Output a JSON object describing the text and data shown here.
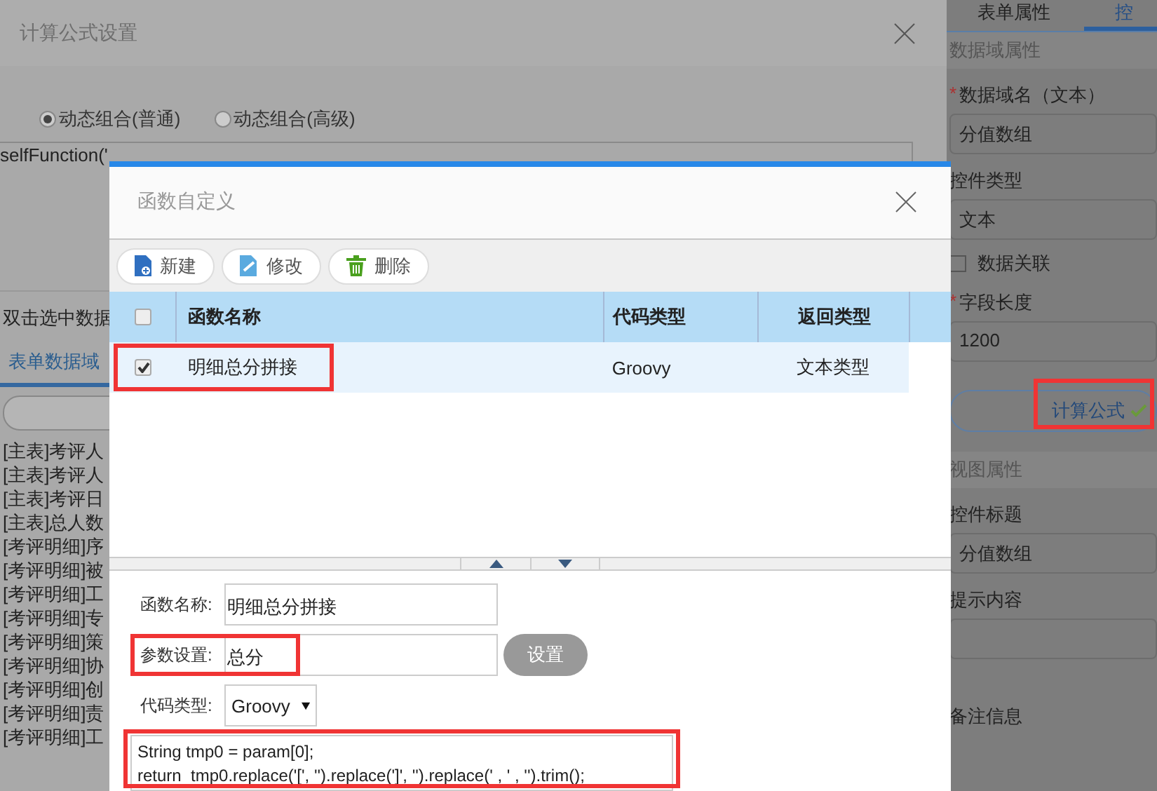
{
  "back_dialog": {
    "title": "计算公式设置",
    "radios": [
      {
        "label": "动态组合(普通)",
        "selected": true
      },
      {
        "label": "动态组合(高级)",
        "selected": false
      }
    ],
    "formula": "selfFunction('",
    "hint": "双击选中数据",
    "tab": "表单数据域",
    "fields": [
      "[主表]考评人",
      "[主表]考评人",
      "[主表]考评日",
      "[主表]总人数",
      "[考评明细]序",
      "[考评明细]被",
      "[考评明细]工",
      "[考评明细]专",
      "[考评明细]策",
      "[考评明细]协",
      "[考评明细]创",
      "[考评明细]责",
      "[考评明细]工"
    ]
  },
  "side_panel": {
    "tabs": [
      {
        "label": "表单属性",
        "selected": false
      },
      {
        "label": "控",
        "selected": true
      }
    ],
    "sections": [
      {
        "title": "数据域属性",
        "items": [
          {
            "kind": "field",
            "mark": "*",
            "label": "数据域名（文本）",
            "value": "分值数组"
          },
          {
            "kind": "field",
            "label": "控件类型",
            "value": "文本"
          },
          {
            "kind": "checkbox",
            "label": "数据关联",
            "checked": false
          },
          {
            "kind": "field",
            "mark": "*",
            "label": "字段长度",
            "value": "1200"
          },
          {
            "kind": "formula",
            "label": "计算公式",
            "set": true,
            "highlighted": true
          }
        ]
      },
      {
        "title": "视图属性",
        "items": [
          {
            "kind": "field",
            "label": "控件标题",
            "value": "分值数组"
          },
          {
            "kind": "field",
            "label": "提示内容"
          },
          {
            "kind": "label",
            "label": "备注信息"
          }
        ]
      }
    ]
  },
  "modal": {
    "title": "函数自定义",
    "toolbar": [
      {
        "kind": "new",
        "label": "新建"
      },
      {
        "kind": "edit",
        "label": "修改"
      },
      {
        "kind": "delete",
        "label": "删除"
      }
    ],
    "select_all": false,
    "columns": [
      "函数名称",
      "代码类型",
      "返回类型"
    ],
    "rows": [
      {
        "checked": true,
        "highlighted": true,
        "cells": [
          "明细总分拼接",
          "Groovy",
          "文本类型"
        ]
      }
    ],
    "form": {
      "name_label": "函数名称:",
      "name_value": "明细总分拼接",
      "param_label": "参数设置:",
      "param_value": "总分",
      "param_highlighted": true,
      "set_button": "设置",
      "type_label": "代码类型:",
      "type_value": "Groovy",
      "code_highlighted": true,
      "code": [
        "String tmp0 = param[0];",
        "return  tmp0.replace('[', '').replace(']', '').replace(' , ' , '').trim();"
      ]
    }
  }
}
